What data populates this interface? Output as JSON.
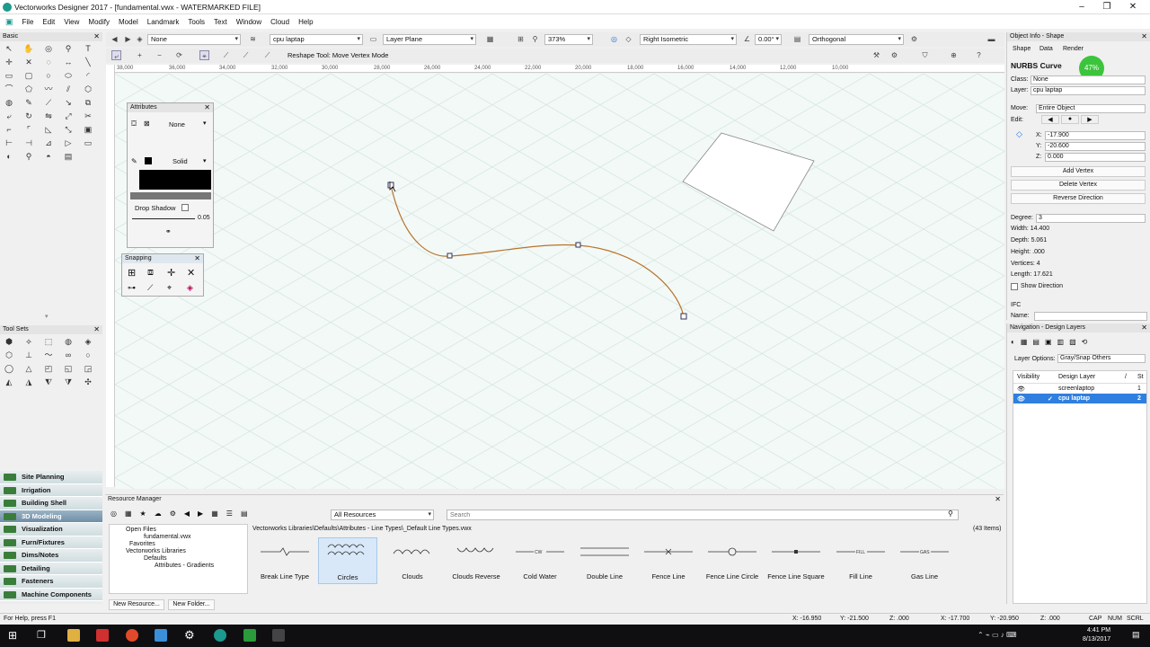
{
  "window": {
    "title": "Vectorworks Designer 2017 - [fundamental.vwx - WATERMARKED FILE]"
  },
  "menu": [
    "File",
    "Edit",
    "View",
    "Modify",
    "Model",
    "Landmark",
    "Tools",
    "Text",
    "Window",
    "Cloud",
    "Help"
  ],
  "viewbar": {
    "class": "None",
    "layer": "cpu laptap",
    "plane": "Layer Plane",
    "zoom": "373%",
    "view": "Right Isometric",
    "angle": "0.00°",
    "projection": "Orthogonal"
  },
  "modebar": {
    "mode_text": "Reshape Tool: Move Vertex Mode"
  },
  "ruler_ticks": [
    "38,000",
    "36,000",
    "34,000",
    "32,000",
    "30,000",
    "28,000",
    "26,000",
    "24,000",
    "22,000",
    "20,000",
    "18,000",
    "16,000",
    "14,000",
    "12,000",
    "10,000"
  ],
  "basic_palette": {
    "title": "Basic"
  },
  "toolsets": {
    "title": "Tool Sets"
  },
  "workspaces": [
    "Site Planning",
    "Irrigation",
    "Building Shell",
    "3D Modeling",
    "Visualization",
    "Furn/Fixtures",
    "Dims/Notes",
    "Detailing",
    "Fasteners",
    "Machine Components"
  ],
  "workspace_selected": "3D Modeling",
  "attributes": {
    "title": "Attributes",
    "fill": "None",
    "pen": "Solid",
    "drop_shadow": "Drop Shadow",
    "line_weight": "0.05"
  },
  "snapping": {
    "title": "Snapping"
  },
  "object_info": {
    "title": "Object Info - Shape",
    "tabs": [
      "Shape",
      "Data",
      "Render"
    ],
    "object_type": "NURBS Curve",
    "badge": "47%",
    "class_label": "Class:",
    "class_value": "None",
    "layer_label": "Layer:",
    "layer_value": "cpu laptap",
    "move_label": "Move:",
    "move_value": "Entire Object",
    "edit_label": "Edit:",
    "x_label": "X:",
    "x_value": "-17.900",
    "y_label": "Y:",
    "y_value": "-20.600",
    "z_label": "Z:",
    "z_value": "0.000",
    "buttons": [
      "Add Vertex",
      "Delete Vertex",
      "Reverse Direction"
    ],
    "degree_label": "Degree:",
    "degree_value": "3",
    "width": "Width:   14.400",
    "depth": "Depth:   5.061",
    "height": "Height:   .000",
    "vertices": "Vertices: 4",
    "length": "Length:   17.621",
    "show_direction": "Show Direction",
    "ifc": "IFC",
    "name_label": "Name:"
  },
  "navigation": {
    "title": "Navigation - Design Layers",
    "layer_options_label": "Layer Options:",
    "layer_options_value": "Gray/Snap Others",
    "cols": [
      "Visibility",
      "Design Layer",
      "/",
      "St"
    ],
    "rows": [
      {
        "name": "screenlaptop",
        "num": "1",
        "selected": false
      },
      {
        "name": "cpu laptap",
        "num": "2",
        "selected": true
      }
    ]
  },
  "resource_manager": {
    "title": "Resource Manager",
    "filter": "All Resources",
    "search_placeholder": "Search",
    "path": "Vectorworks Libraries\\Defaults\\Attributes - Line Types\\_Default Line Types.vwx",
    "count": "(43 Items)",
    "tree": [
      "Open Files",
      "fundamental.vwx",
      "Favorites",
      "Vectorworks Libraries",
      "Defaults",
      "Attributes - Gradients"
    ],
    "buttons": [
      "New Resource...",
      "New Folder..."
    ],
    "items": [
      "Break Line Type",
      "Circles",
      "Clouds",
      "Clouds Reverse",
      "Cold Water",
      "Double Line",
      "Fence Line",
      "Fence Line Circle",
      "Fence Line Square",
      "Fill Line",
      "Gas Line"
    ],
    "selected_item": "Circles"
  },
  "status": {
    "help": "For Help, press F1",
    "x1": "X: -16.950",
    "y1": "Y: -21.500",
    "z1": "Z: .000",
    "x2": "X: -17.700",
    "y2": "Y: -20.950",
    "z2": "Z: .000",
    "caps": "CAP",
    "num": "NUM",
    "scrl": "SCRL"
  },
  "taskbar": {
    "time": "4:41 PM",
    "date": "8/13/2017"
  }
}
